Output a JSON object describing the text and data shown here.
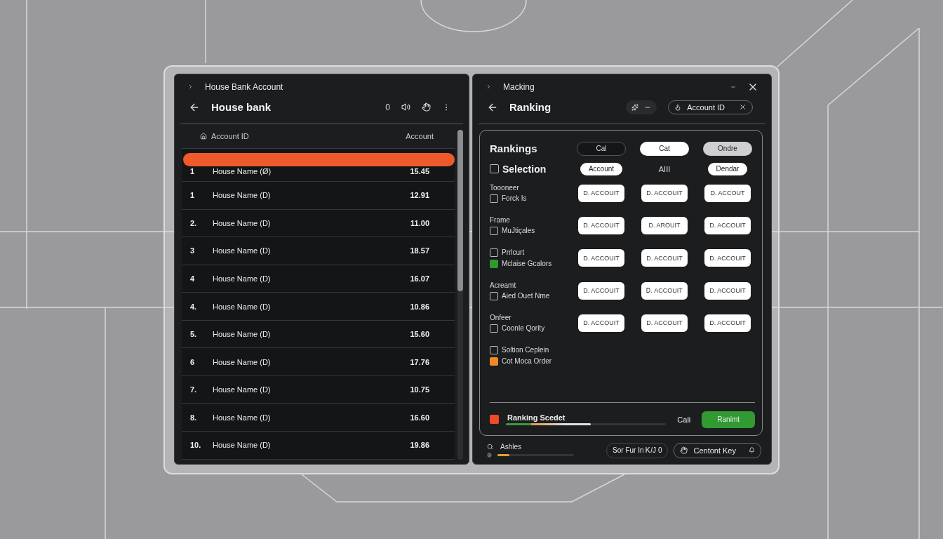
{
  "left_panel": {
    "breadcrumb": "House Bank Account",
    "title": "House bank",
    "header_text": "0",
    "columns": [
      "Account ID",
      "Account"
    ],
    "rows": [
      {
        "number": "1",
        "name": "House Name (Ø)",
        "amount": "15.45",
        "selected": true
      },
      {
        "number": "1",
        "name": "House Name (D)",
        "amount": "12.91",
        "selected": false
      },
      {
        "number": "2.",
        "name": "House Name (D)",
        "amount": "11.00",
        "selected": false
      },
      {
        "number": "3",
        "name": "House Name (D)",
        "amount": "18.57",
        "selected": false
      },
      {
        "number": "4",
        "name": "House Name (D)",
        "amount": "16.07",
        "selected": false
      },
      {
        "number": "4.",
        "name": "House Name (D)",
        "amount": "10.86",
        "selected": false
      },
      {
        "number": "5.",
        "name": "House Name (D)",
        "amount": "15.60",
        "selected": false
      },
      {
        "number": "6",
        "name": "House Name (D)",
        "amount": "17.76",
        "selected": false
      },
      {
        "number": "7.",
        "name": "House Name (D)",
        "amount": "10.75",
        "selected": false
      },
      {
        "number": "8.",
        "name": "House Name (D)",
        "amount": "16.60",
        "selected": false
      },
      {
        "number": "10.",
        "name": "House Name (D)",
        "amount": "19.86",
        "selected": false
      }
    ]
  },
  "right_panel": {
    "breadcrumb": "Macking",
    "title": "Ranking",
    "filter_chip": "Account ID",
    "card": {
      "heading": "Rankings",
      "selection": {
        "label": "Selection",
        "checked": false
      },
      "segments": [
        {
          "label": "Cal",
          "kind": "outline"
        },
        {
          "label": "Cat",
          "kind": "filled"
        },
        {
          "label": "Ondre",
          "kind": "muted"
        }
      ],
      "subheads": [
        {
          "label": "Account",
          "kind": "pill"
        },
        {
          "label": "AIII",
          "kind": "plain"
        },
        {
          "label": "Dendar",
          "kind": "pill"
        }
      ],
      "groups": [
        {
          "label": "Toooneer",
          "checks": [
            {
              "label": "Forck Is",
              "checked": false
            }
          ],
          "buttons": [
            "D. ACCOUIT",
            "D. ACCOUIT",
            "D. ACCOUT"
          ]
        },
        {
          "label": "Frame",
          "checks": [
            {
              "label": "MuJtiçales",
              "checked": false
            }
          ],
          "buttons": [
            "D. ACCOUIT",
            "D. AROUIT",
            "D. ACCOUIT"
          ]
        },
        {
          "checks": [
            {
              "label": "Prrlcurt",
              "checked": false
            },
            {
              "label": "Mclaise Gcalors",
              "checked": true,
              "color": "#2e9a2e"
            }
          ],
          "buttons": [
            "D. ACCOUIT",
            "D. ACCOUIT",
            "D. ACCOUIT"
          ]
        },
        {
          "label": "Acreamt",
          "checks": [
            {
              "label": "Aied Ouet Nme",
              "checked": false
            }
          ],
          "buttons": [
            "D. ACCOUIT",
            "Ꭰ. ACCOUIT",
            "D. ACCOUIT"
          ]
        },
        {
          "label": "Onfeer",
          "checks": [
            {
              "label": "Coonle Qority",
              "checked": false
            }
          ],
          "buttons": [
            "D. ACCOUIT",
            "D. ACCOUIT",
            "D. ACCOUIT"
          ]
        }
      ],
      "extra_checks": [
        {
          "label": "Soltion Ceplein",
          "checked": false
        },
        {
          "label": "Cot Moca Order",
          "checked": true,
          "color": "#f08a24"
        }
      ],
      "footer": {
        "label": "Ranking Scedet",
        "level": 0.53,
        "cancel": "Cali",
        "confirm": "Ranimt"
      }
    },
    "status": {
      "label": "Ashles",
      "level": 0.16,
      "button": "Sor Fur In Ꮶ/J 0",
      "chip": "Centont Key"
    }
  }
}
